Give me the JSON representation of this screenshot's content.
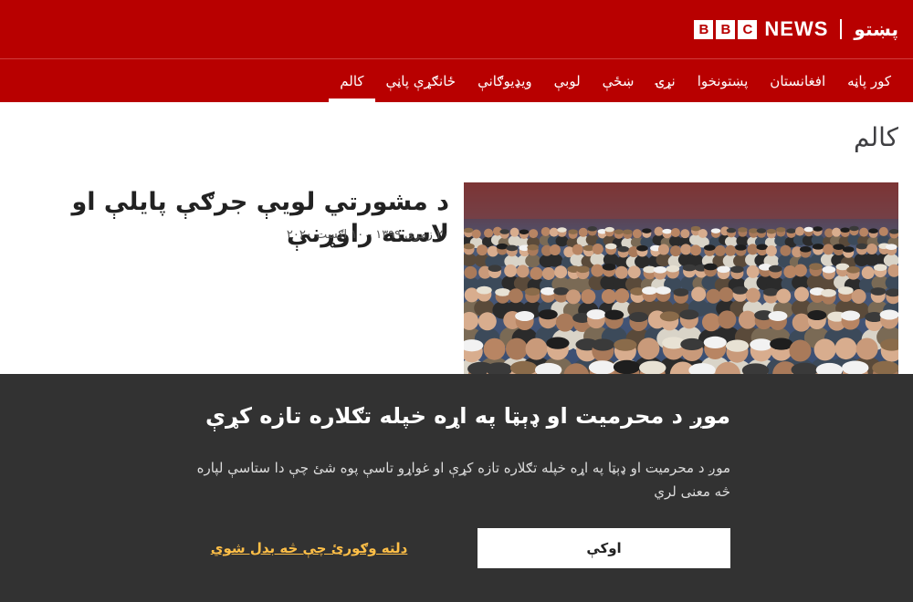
{
  "header": {
    "logo_letters": [
      "B",
      "B",
      "C"
    ],
    "logo_word": "NEWS",
    "service_name": "پښتو"
  },
  "nav": {
    "items": [
      {
        "label": "کور پاڼه"
      },
      {
        "label": "افغانستان"
      },
      {
        "label": "پښتونخوا"
      },
      {
        "label": "نړۍ"
      },
      {
        "label": "ښځې"
      },
      {
        "label": "لوبې"
      },
      {
        "label": "ویډیوګانې"
      },
      {
        "label": "ځانګړې پاڼې"
      },
      {
        "label": "کالم",
        "active": true
      }
    ]
  },
  "page": {
    "heading": "کالم"
  },
  "story": {
    "title": "د مشورتي لویې جرګې پایلې او لاسته راوړنې",
    "date": "۲۰ زمری ۱۳۹۹ - ۱۰ اګست ۲۰۲۰"
  },
  "consent": {
    "title": "موږ د محرمیت او ډېټا په اړه خپله تګلاره تازه کړې",
    "body": "موږ د محرمیت او ډېټا په اړه خپله تګلاره تازه کړې او غواړو تاسې پوه شئ چې دا ستاسې لپاره څه معنی لري",
    "ok_label": "اوکې",
    "link_label": "دلته وګورئ چې څه بدل شوي"
  },
  "colors": {
    "brand_red": "#b80000",
    "consent_bg": "#323232",
    "link_gold": "#ffbf47"
  }
}
